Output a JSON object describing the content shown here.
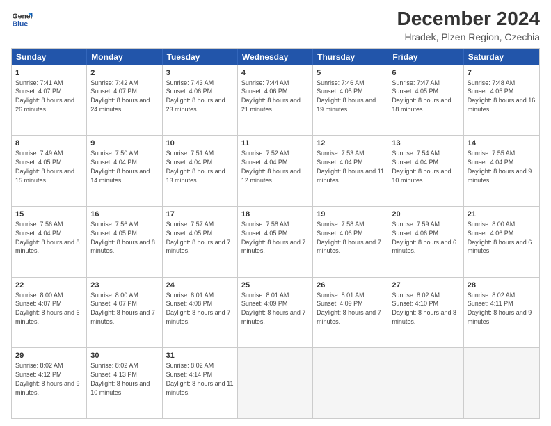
{
  "logo": {
    "line1": "General",
    "line2": "Blue"
  },
  "title": "December 2024",
  "subtitle": "Hradek, Plzen Region, Czechia",
  "header_days": [
    "Sunday",
    "Monday",
    "Tuesday",
    "Wednesday",
    "Thursday",
    "Friday",
    "Saturday"
  ],
  "weeks": [
    [
      {
        "day": "1",
        "sunrise": "Sunrise: 7:41 AM",
        "sunset": "Sunset: 4:07 PM",
        "daylight": "Daylight: 8 hours and 26 minutes."
      },
      {
        "day": "2",
        "sunrise": "Sunrise: 7:42 AM",
        "sunset": "Sunset: 4:07 PM",
        "daylight": "Daylight: 8 hours and 24 minutes."
      },
      {
        "day": "3",
        "sunrise": "Sunrise: 7:43 AM",
        "sunset": "Sunset: 4:06 PM",
        "daylight": "Daylight: 8 hours and 23 minutes."
      },
      {
        "day": "4",
        "sunrise": "Sunrise: 7:44 AM",
        "sunset": "Sunset: 4:06 PM",
        "daylight": "Daylight: 8 hours and 21 minutes."
      },
      {
        "day": "5",
        "sunrise": "Sunrise: 7:46 AM",
        "sunset": "Sunset: 4:05 PM",
        "daylight": "Daylight: 8 hours and 19 minutes."
      },
      {
        "day": "6",
        "sunrise": "Sunrise: 7:47 AM",
        "sunset": "Sunset: 4:05 PM",
        "daylight": "Daylight: 8 hours and 18 minutes."
      },
      {
        "day": "7",
        "sunrise": "Sunrise: 7:48 AM",
        "sunset": "Sunset: 4:05 PM",
        "daylight": "Daylight: 8 hours and 16 minutes."
      }
    ],
    [
      {
        "day": "8",
        "sunrise": "Sunrise: 7:49 AM",
        "sunset": "Sunset: 4:05 PM",
        "daylight": "Daylight: 8 hours and 15 minutes."
      },
      {
        "day": "9",
        "sunrise": "Sunrise: 7:50 AM",
        "sunset": "Sunset: 4:04 PM",
        "daylight": "Daylight: 8 hours and 14 minutes."
      },
      {
        "day": "10",
        "sunrise": "Sunrise: 7:51 AM",
        "sunset": "Sunset: 4:04 PM",
        "daylight": "Daylight: 8 hours and 13 minutes."
      },
      {
        "day": "11",
        "sunrise": "Sunrise: 7:52 AM",
        "sunset": "Sunset: 4:04 PM",
        "daylight": "Daylight: 8 hours and 12 minutes."
      },
      {
        "day": "12",
        "sunrise": "Sunrise: 7:53 AM",
        "sunset": "Sunset: 4:04 PM",
        "daylight": "Daylight: 8 hours and 11 minutes."
      },
      {
        "day": "13",
        "sunrise": "Sunrise: 7:54 AM",
        "sunset": "Sunset: 4:04 PM",
        "daylight": "Daylight: 8 hours and 10 minutes."
      },
      {
        "day": "14",
        "sunrise": "Sunrise: 7:55 AM",
        "sunset": "Sunset: 4:04 PM",
        "daylight": "Daylight: 8 hours and 9 minutes."
      }
    ],
    [
      {
        "day": "15",
        "sunrise": "Sunrise: 7:56 AM",
        "sunset": "Sunset: 4:04 PM",
        "daylight": "Daylight: 8 hours and 8 minutes."
      },
      {
        "day": "16",
        "sunrise": "Sunrise: 7:56 AM",
        "sunset": "Sunset: 4:05 PM",
        "daylight": "Daylight: 8 hours and 8 minutes."
      },
      {
        "day": "17",
        "sunrise": "Sunrise: 7:57 AM",
        "sunset": "Sunset: 4:05 PM",
        "daylight": "Daylight: 8 hours and 7 minutes."
      },
      {
        "day": "18",
        "sunrise": "Sunrise: 7:58 AM",
        "sunset": "Sunset: 4:05 PM",
        "daylight": "Daylight: 8 hours and 7 minutes."
      },
      {
        "day": "19",
        "sunrise": "Sunrise: 7:58 AM",
        "sunset": "Sunset: 4:06 PM",
        "daylight": "Daylight: 8 hours and 7 minutes."
      },
      {
        "day": "20",
        "sunrise": "Sunrise: 7:59 AM",
        "sunset": "Sunset: 4:06 PM",
        "daylight": "Daylight: 8 hours and 6 minutes."
      },
      {
        "day": "21",
        "sunrise": "Sunrise: 8:00 AM",
        "sunset": "Sunset: 4:06 PM",
        "daylight": "Daylight: 8 hours and 6 minutes."
      }
    ],
    [
      {
        "day": "22",
        "sunrise": "Sunrise: 8:00 AM",
        "sunset": "Sunset: 4:07 PM",
        "daylight": "Daylight: 8 hours and 6 minutes."
      },
      {
        "day": "23",
        "sunrise": "Sunrise: 8:00 AM",
        "sunset": "Sunset: 4:07 PM",
        "daylight": "Daylight: 8 hours and 7 minutes."
      },
      {
        "day": "24",
        "sunrise": "Sunrise: 8:01 AM",
        "sunset": "Sunset: 4:08 PM",
        "daylight": "Daylight: 8 hours and 7 minutes."
      },
      {
        "day": "25",
        "sunrise": "Sunrise: 8:01 AM",
        "sunset": "Sunset: 4:09 PM",
        "daylight": "Daylight: 8 hours and 7 minutes."
      },
      {
        "day": "26",
        "sunrise": "Sunrise: 8:01 AM",
        "sunset": "Sunset: 4:09 PM",
        "daylight": "Daylight: 8 hours and 7 minutes."
      },
      {
        "day": "27",
        "sunrise": "Sunrise: 8:02 AM",
        "sunset": "Sunset: 4:10 PM",
        "daylight": "Daylight: 8 hours and 8 minutes."
      },
      {
        "day": "28",
        "sunrise": "Sunrise: 8:02 AM",
        "sunset": "Sunset: 4:11 PM",
        "daylight": "Daylight: 8 hours and 9 minutes."
      }
    ],
    [
      {
        "day": "29",
        "sunrise": "Sunrise: 8:02 AM",
        "sunset": "Sunset: 4:12 PM",
        "daylight": "Daylight: 8 hours and 9 minutes."
      },
      {
        "day": "30",
        "sunrise": "Sunrise: 8:02 AM",
        "sunset": "Sunset: 4:13 PM",
        "daylight": "Daylight: 8 hours and 10 minutes."
      },
      {
        "day": "31",
        "sunrise": "Sunrise: 8:02 AM",
        "sunset": "Sunset: 4:14 PM",
        "daylight": "Daylight: 8 hours and 11 minutes."
      },
      {
        "day": "",
        "sunrise": "",
        "sunset": "",
        "daylight": ""
      },
      {
        "day": "",
        "sunrise": "",
        "sunset": "",
        "daylight": ""
      },
      {
        "day": "",
        "sunrise": "",
        "sunset": "",
        "daylight": ""
      },
      {
        "day": "",
        "sunrise": "",
        "sunset": "",
        "daylight": ""
      }
    ]
  ]
}
